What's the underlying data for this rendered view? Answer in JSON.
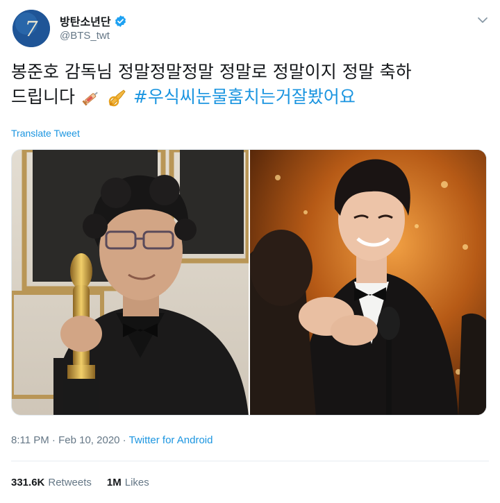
{
  "user": {
    "display_name": "방탄소년단",
    "handle": "@BTS_twt",
    "verified": true,
    "avatar_icon": "avatar-7-logo"
  },
  "tweet": {
    "line1": "봉준호 감독님 정말정말정말 정말로 정말이지 정말 축하",
    "line2": "드립니다",
    "emojis": [
      "syringe-emoji",
      "trumpet-emoji"
    ],
    "hashtag": "#우식씨눈물훔치는거잘봤어요",
    "translate_label": "Translate Tweet"
  },
  "media": {
    "count": 2,
    "items": [
      "photo-director-with-oscar",
      "photo-actor-smiling"
    ]
  },
  "meta": {
    "time": "8:11 PM",
    "separator": "·",
    "date": "Feb 10, 2020",
    "source": "Twitter for Android"
  },
  "stats": {
    "retweets_count": "331.6K",
    "retweets_label": "Retweets",
    "likes_count": "1M",
    "likes_label": "Likes"
  },
  "colors": {
    "accent": "#1b95e0",
    "secondary_text": "#657786",
    "primary_text": "#14171a",
    "divider": "#e6ecf0"
  }
}
